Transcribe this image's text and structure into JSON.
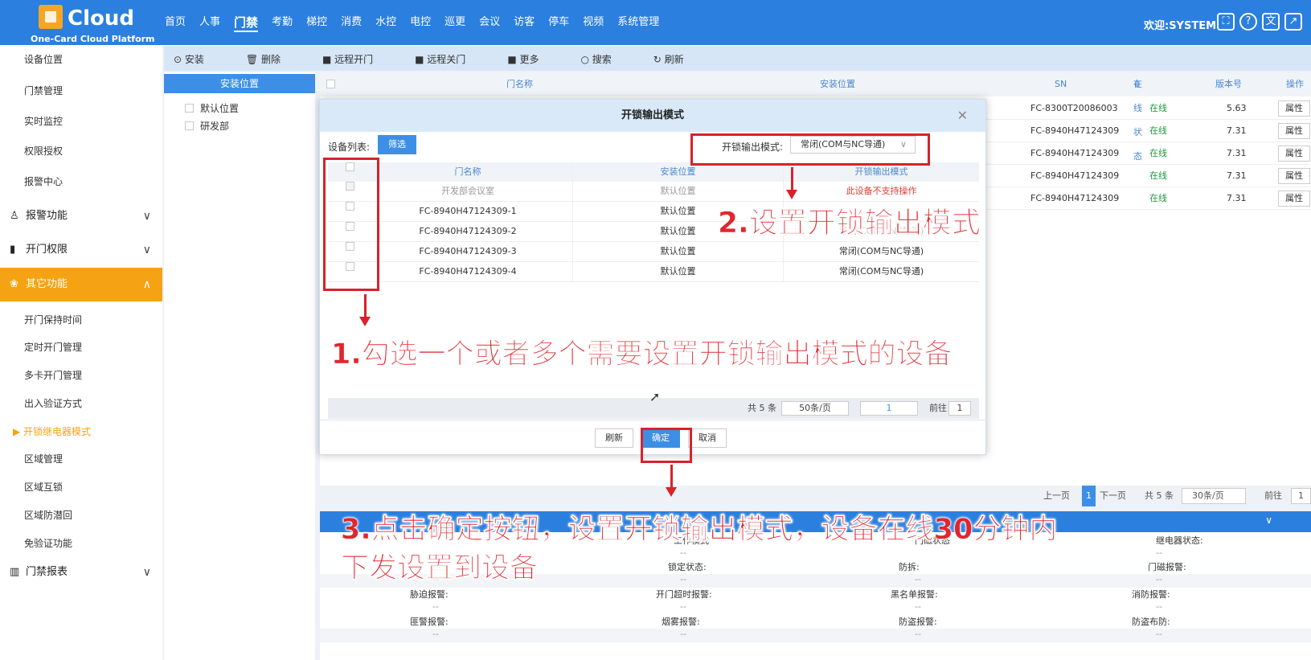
{
  "header": {
    "brand": "Cloud",
    "subtitle": "One-Card Cloud Platform",
    "nav": [
      "首页",
      "人事",
      "门禁",
      "考勤",
      "梯控",
      "消费",
      "水控",
      "电控",
      "巡更",
      "会议",
      "访客",
      "停车",
      "视频",
      "系统管理"
    ],
    "active_nav": "门禁",
    "welcome": "欢迎:SYSTEM"
  },
  "sidebar": {
    "top_items": [
      "设备位置",
      "门禁管理",
      "实时监控",
      "权限授权",
      "报警中心"
    ],
    "groups": [
      {
        "label": "报警功能",
        "icon": "alarm-icon",
        "chevron": "∨"
      },
      {
        "label": "开门权限",
        "icon": "door-icon",
        "chevron": "∨"
      },
      {
        "label": "其它功能",
        "icon": "grid-icon",
        "chevron": "∧"
      }
    ],
    "sub_items": [
      "开门保持时间",
      "定时开门管理",
      "多卡开门管理",
      "出入验证方式",
      "开锁继电器模式",
      "区域管理",
      "区域互锁",
      "区域防潜回",
      "免验证功能"
    ],
    "current_item": "开锁继电器模式",
    "report_group": {
      "label": "门禁报表",
      "icon": "chart-icon",
      "chevron": "∨"
    }
  },
  "toolbar": {
    "buttons": [
      "安装",
      "删除",
      "远程开门",
      "远程关门",
      "更多",
      "搜索",
      "刷新"
    ]
  },
  "location_panel": {
    "title": "安装位置",
    "items": [
      "默认位置",
      "研发部"
    ]
  },
  "grid": {
    "columns": [
      "门名称",
      "安装位置",
      "SN",
      "在线状态",
      "版本号",
      "操作"
    ],
    "rows": [
      {
        "sn": "FC-8300T20086003",
        "status": "在线",
        "version": "5.63",
        "op": "属性"
      },
      {
        "sn": "FC-8940H47124309",
        "status": "在线",
        "version": "7.31",
        "op": "属性"
      },
      {
        "sn": "FC-8940H47124309",
        "status": "在线",
        "version": "7.31",
        "op": "属性"
      },
      {
        "sn": "FC-8940H47124309",
        "status": "在线",
        "version": "7.31",
        "op": "属性"
      },
      {
        "sn": "FC-8940H47124309",
        "status": "在线",
        "version": "7.31",
        "op": "属性"
      }
    ],
    "pager": {
      "prev": "上一页",
      "page": "1",
      "next": "下一页",
      "total": "共 5 条",
      "size": "30条/页",
      "goto": "前往",
      "goto_value": "1"
    }
  },
  "detail": {
    "rows": [
      [
        "工作模式",
        "门磁状态",
        "继电器状态:"
      ],
      [
        "锁定状态:",
        "防拆:",
        "门磁报警:"
      ],
      [
        "胁迫报警:",
        "开门超时报警:",
        "黑名单报警:",
        "消防报警:"
      ],
      [
        "匪警报警:",
        "烟雾报警:",
        "防盗报警:",
        "防盗布防:"
      ]
    ],
    "empty_value": "--"
  },
  "modal": {
    "title": "开锁输出模式",
    "device_list_label": "设备列表:",
    "filter_button": "筛选",
    "mode_label": "开锁输出模式:",
    "mode_value": "常闭(COM与NC导通)",
    "columns": [
      "门名称",
      "安装位置",
      "开锁输出模式"
    ],
    "rows": [
      {
        "name": "开发部会议室",
        "location": "默认位置",
        "mode": "此设备不支持操作",
        "disabled": true
      },
      {
        "name": "FC-8940H47124309-1",
        "location": "默认位置",
        "mode": "常闭(COM与NC导通)"
      },
      {
        "name": "FC-8940H47124309-2",
        "location": "默认位置",
        "mode": "常闭(COM与NC导通)"
      },
      {
        "name": "FC-8940H47124309-3",
        "location": "默认位置",
        "mode": "常闭(COM与NC导通)"
      },
      {
        "name": "FC-8940H47124309-4",
        "location": "默认位置",
        "mode": "常闭(COM与NC导通)"
      }
    ],
    "pager": {
      "total": "共 5 条",
      "size": "50条/页",
      "page": "1",
      "goto": "前往",
      "goto_value": "1",
      "page_unit": "页"
    },
    "buttons": {
      "refresh": "刷新",
      "confirm": "确定",
      "cancel": "取消"
    }
  },
  "annotations": {
    "step1": "1.勾选一个或者多个需要设置开锁输出模式的设备",
    "step2": "2.设置开锁输出模式",
    "step3_line1": "3.点击确定按钮，设置开锁输出模式，设备在线30分钟内",
    "step3_line2": "下发设置到设备",
    "color": "#e0262e"
  },
  "colors": {
    "primary": "#2b7fde",
    "accent": "#f5a314",
    "online": "#1c9a3a"
  }
}
